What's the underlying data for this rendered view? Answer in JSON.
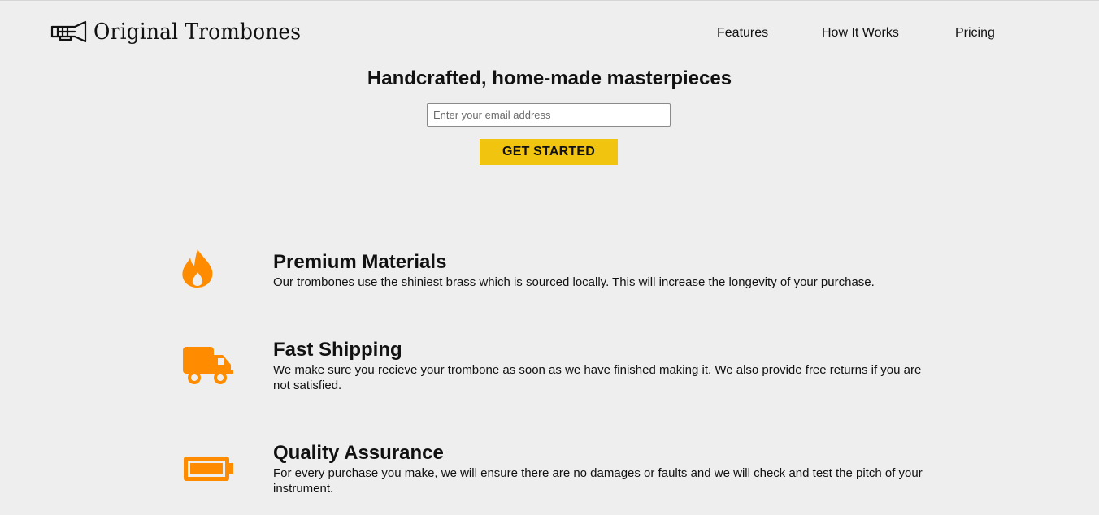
{
  "header": {
    "logo_text": "Original Trombones",
    "logo_icon": "trombone-icon",
    "nav": [
      "Features",
      "How It Works",
      "Pricing"
    ]
  },
  "hero": {
    "title": "Handcrafted, home-made masterpieces",
    "email_placeholder": "Enter your email address",
    "cta_label": "GET STARTED"
  },
  "features": [
    {
      "icon": "fire-icon",
      "title": "Premium Materials",
      "description": "Our trombones use the shiniest brass which is sourced locally. This will increase the longevity of your purchase."
    },
    {
      "icon": "truck-icon",
      "title": "Fast Shipping",
      "description": "We make sure you recieve your trombone as soon as we have finished making it. We also provide free returns if you are not satisfied."
    },
    {
      "icon": "battery-icon",
      "title": "Quality Assurance",
      "description": "For every purchase you make, we will ensure there are no damages or faults and we will check and test the pitch of your instrument."
    }
  ],
  "colors": {
    "background": "#eeeeee",
    "accent_orange": "#ff8c00",
    "cta_yellow": "#f1c40f",
    "text": "#111111"
  }
}
